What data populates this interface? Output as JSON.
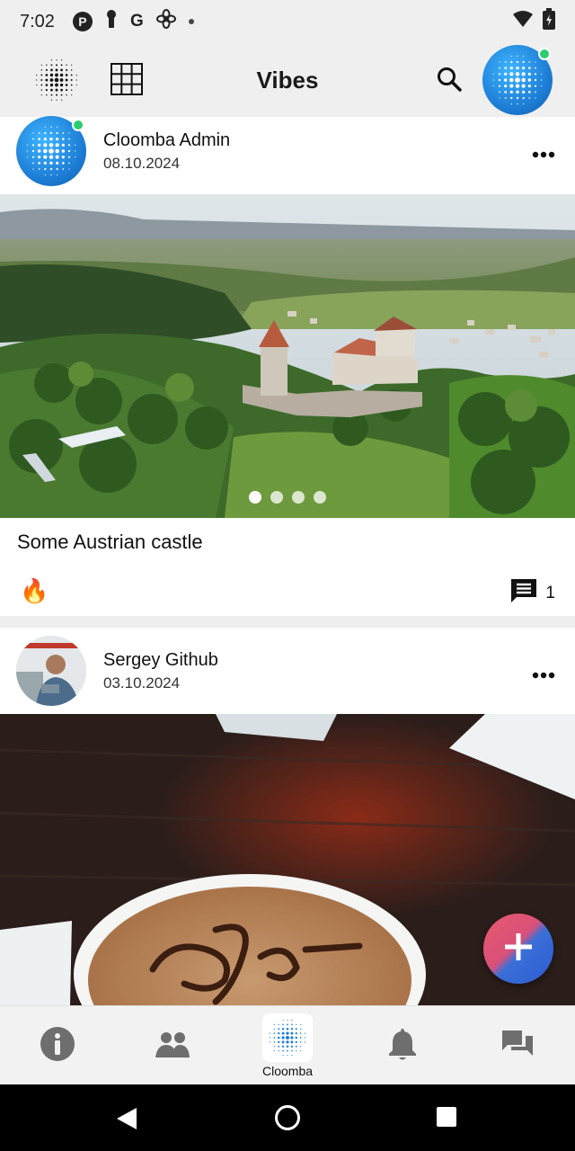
{
  "status_bar": {
    "time": "7:02",
    "icons": [
      "parking-icon",
      "keyhole-icon",
      "google-icon",
      "fan-icon",
      "dot-icon"
    ],
    "right_icons": [
      "wifi-icon",
      "battery-icon"
    ],
    "google_letter": "G",
    "parking_letter": "P"
  },
  "top_bar": {
    "title": "Vibes",
    "left_icons": [
      "dot-grid-logo-icon",
      "grid-view-icon"
    ],
    "right_icons": [
      "search-icon",
      "profile-avatar"
    ]
  },
  "posts": [
    {
      "author": "Cloomba Admin",
      "date": "08.10.2024",
      "caption": "Some Austrian castle",
      "reaction": "🔥",
      "comments_count": "1",
      "image_pages": 4,
      "active_page": 1
    },
    {
      "author": "Sergey Github",
      "date": "03.10.2024"
    }
  ],
  "bottom_nav": {
    "items": [
      {
        "icon": "info-icon",
        "label": ""
      },
      {
        "icon": "people-icon",
        "label": ""
      },
      {
        "icon": "cloomba-logo-icon",
        "label": "Cloomba"
      },
      {
        "icon": "bell-icon",
        "label": ""
      },
      {
        "icon": "chat-icon",
        "label": ""
      }
    ]
  },
  "fab": {
    "icon": "plus-icon"
  },
  "colors": {
    "accent_blue": "#1e7fd6",
    "online": "#2ecc71",
    "fab_red": "#e85a6a",
    "fab_blue": "#2c5bd0"
  }
}
